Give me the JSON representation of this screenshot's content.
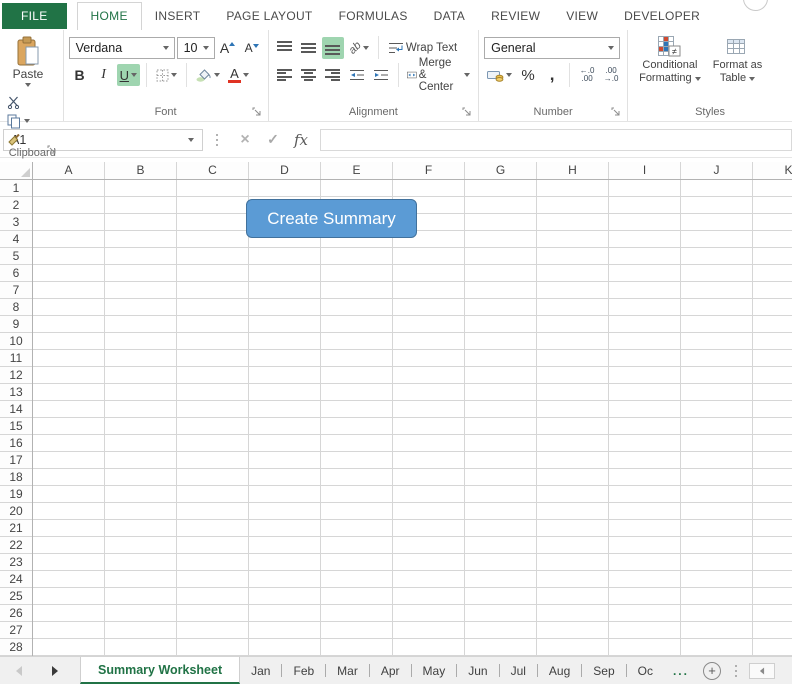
{
  "colors": {
    "excel_green": "#217346",
    "toggle_highlight": "#9fd5b0",
    "button_fill": "#5b9bd5",
    "button_border": "#41719c",
    "font_color_red": "#e03323",
    "fill_sample_green": "#c6e0b4",
    "icon_blue": "#2e75b6",
    "icon_red": "#d0492f"
  },
  "ribbon": {
    "tabs": [
      {
        "label": "FILE",
        "type": "file"
      },
      {
        "label": "HOME",
        "active": true
      },
      {
        "label": "INSERT"
      },
      {
        "label": "PAGE LAYOUT"
      },
      {
        "label": "FORMULAS"
      },
      {
        "label": "DATA"
      },
      {
        "label": "REVIEW"
      },
      {
        "label": "VIEW"
      },
      {
        "label": "DEVELOPER"
      }
    ],
    "clipboard": {
      "group_label": "Clipboard",
      "paste_label": "Paste"
    },
    "font": {
      "group_label": "Font",
      "font_name": "Verdana",
      "font_size": "10",
      "bold": "B",
      "italic": "I",
      "underline": "U",
      "grow_font": "A",
      "shrink_font": "A",
      "font_color_letter": "A"
    },
    "alignment": {
      "group_label": "Alignment",
      "wrap_text": "Wrap Text",
      "merge_center": "Merge & Center",
      "orientation": "ab"
    },
    "number": {
      "group_label": "Number",
      "format": "General",
      "percent": "%",
      "comma": ",",
      "increase_decimal": {
        "line1": "←.0",
        "line2": ".00"
      },
      "decrease_decimal": {
        "line1": ".00",
        "line2": "→.0"
      }
    },
    "styles": {
      "group_label": "Styles",
      "conditional_line1": "Conditional",
      "conditional_line2": "Formatting",
      "format_table_line1": "Format as",
      "format_table_line2": "Table"
    }
  },
  "formula_bar": {
    "name_box": "A1",
    "fx_label": "fx",
    "cancel": "✕",
    "enter": "✓",
    "value": ""
  },
  "grid": {
    "columns": [
      "A",
      "B",
      "C",
      "D",
      "E",
      "F",
      "G",
      "H",
      "I",
      "J",
      "K"
    ],
    "row_count": 28
  },
  "overlay_button": {
    "label": "Create Summary"
  },
  "sheet_bar": {
    "active_tab": "Summary Worksheet",
    "tabs": [
      "Jan",
      "Feb",
      "Mar",
      "Apr",
      "May",
      "Jun",
      "Jul",
      "Aug",
      "Sep",
      "Oc"
    ],
    "overflow_indicator": "...",
    "add_sheet": "+"
  }
}
